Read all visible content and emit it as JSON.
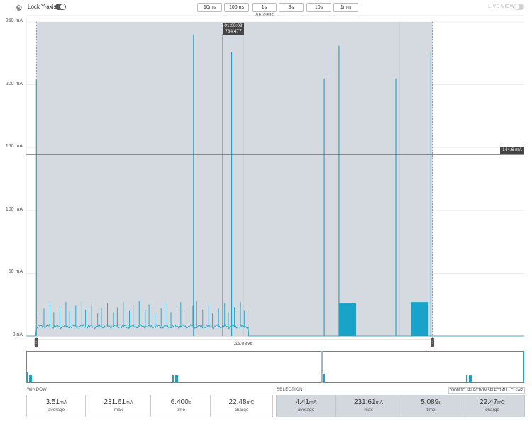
{
  "toolbar": {
    "lock_label": "Lock Y-axis",
    "zoom_buttons": [
      "10ms",
      "100ms",
      "1s",
      "3s",
      "10s",
      "1min"
    ],
    "live_view_label": "LIVE VIEW"
  },
  "chart": {
    "window_delta": "Δ6.400s",
    "selection_delta": "Δ5.089s",
    "y_ticks": [
      "250 mA",
      "200 mA",
      "150 mA",
      "100 mA",
      "50 mA",
      "0 nA"
    ],
    "cursor_time": "01:00:03",
    "cursor_value": "734.477",
    "level_marker": "144.6 mA"
  },
  "chart_data": {
    "type": "line",
    "xlabel": "",
    "ylabel": "",
    "ylim": [
      0,
      250
    ],
    "y_unit": "mA",
    "window_seconds": 6.4,
    "selection": {
      "start_s": 0.13,
      "end_s": 5.22
    },
    "level_mA": 144.6,
    "baseline_mA": 7.5,
    "spikes": [
      {
        "t": 0.13,
        "mA": 204
      },
      {
        "t": 2.15,
        "mA": 240
      },
      {
        "t": 2.64,
        "mA": 226
      },
      {
        "t": 3.83,
        "mA": 205
      },
      {
        "t": 4.02,
        "mA": 231
      },
      {
        "t": 4.75,
        "mA": 205
      },
      {
        "t": 5.2,
        "mA": 226
      }
    ],
    "burst_regions": [
      {
        "start_s": 4.02,
        "end_s": 4.24,
        "mA": 26
      },
      {
        "start_s": 4.95,
        "end_s": 5.17,
        "mA": 27
      }
    ]
  },
  "window_panel": {
    "title": "WINDOW",
    "stats": [
      {
        "value": "3.51",
        "unit": "mA",
        "label": "average"
      },
      {
        "value": "231.61",
        "unit": "mA",
        "label": "max"
      },
      {
        "value": "6.400",
        "unit": "s",
        "label": "time"
      },
      {
        "value": "22.48",
        "unit": "mC",
        "label": "charge"
      }
    ]
  },
  "selection_panel": {
    "title": "SELECTION",
    "actions": [
      "ZOOM TO SELECTION",
      "SELECT ALL",
      "CLEAR"
    ],
    "stats": [
      {
        "value": "4.41",
        "unit": "mA",
        "label": "average"
      },
      {
        "value": "231.61",
        "unit": "mA",
        "label": "max"
      },
      {
        "value": "5.089",
        "unit": "s",
        "label": "time"
      },
      {
        "value": "22.47",
        "unit": "mC",
        "label": "charge"
      }
    ]
  },
  "colors": {
    "trace": "#1aa3c9",
    "selection_fill": "#d2d8de",
    "label_bg": "#444444"
  }
}
